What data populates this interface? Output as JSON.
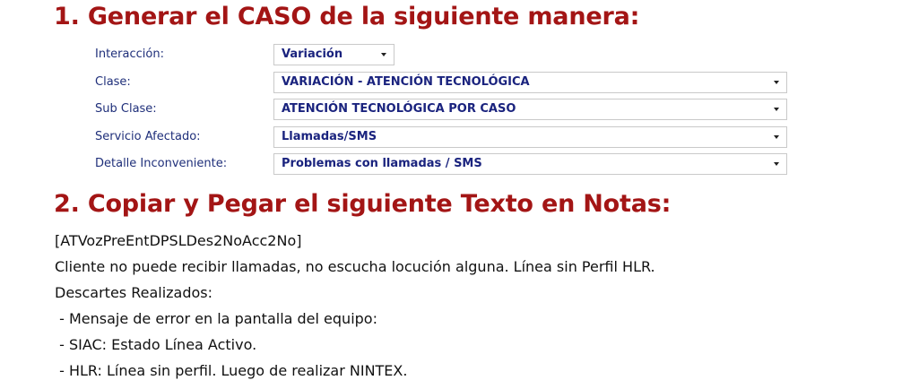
{
  "headings": {
    "step1": "1. Generar el CASO de la siguiente manera:",
    "step2": "2. Copiar y Pegar el siguiente Texto en Notas:"
  },
  "form": {
    "interaccion": {
      "label": "Interacción:",
      "value": "Variación"
    },
    "clase": {
      "label": "Clase:",
      "value": "VARIACIÓN - ATENCIÓN TECNOLÓGICA"
    },
    "sub_clase": {
      "label": "Sub Clase:",
      "value": "ATENCIÓN TECNOLÓGICA POR CASO"
    },
    "servicio": {
      "label": "Servicio Afectado:",
      "value": "Llamadas/SMS"
    },
    "detalle": {
      "label": "Detalle Inconveniente:",
      "value": "Problemas con llamadas / SMS"
    }
  },
  "notes": [
    "[ATVozPreEntDPSLDes2NoAcc2No]",
    "Cliente no puede recibir llamadas, no escucha locución alguna. Línea sin Perfil HLR.",
    "Descartes Realizados:",
    " - Mensaje de error en la pantalla del equipo:",
    " - SIAC: Estado Línea Activo.",
    " - HLR: Línea sin perfil. Luego de realizar NINTEX."
  ],
  "colors": {
    "heading": "#a31515",
    "label": "#1f2f7a",
    "select_text": "#1a237e",
    "select_border": "#c9c9c9",
    "body_text": "#111111"
  },
  "icons": {
    "dropdown": "chevron-down-icon"
  }
}
